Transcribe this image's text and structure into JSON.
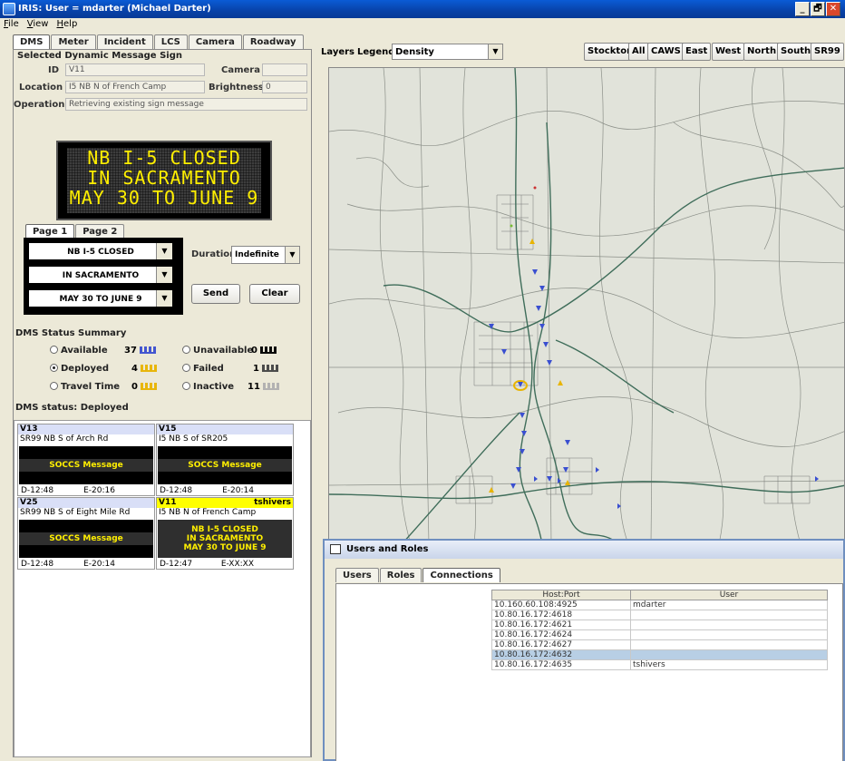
{
  "window": {
    "title": "IRIS: User = mdarter (Michael Darter)",
    "min": "_",
    "max": "🗗",
    "close": "✕"
  },
  "menu": [
    "File",
    "View",
    "Help"
  ],
  "left_tabs": [
    "DMS",
    "Meter",
    "Incident",
    "LCS",
    "Camera",
    "Roadway"
  ],
  "selected_sign": {
    "group_title": "Selected Dynamic Message Sign",
    "id_label": "ID",
    "id_value": "V11",
    "camera_label": "Camera",
    "camera_value": "",
    "location_label": "Location",
    "location_value": "I5 NB N of French Camp",
    "brightness_label": "Brightness",
    "brightness_value": "0",
    "operation_label": "Operation",
    "operation_value": "Retrieving existing sign message",
    "sign_lines": [
      "NB I-5 CLOSED",
      "IN SACRAMENTO",
      "MAY 30 TO JUNE 9"
    ]
  },
  "page_tabs": [
    "Page 1",
    "Page 2"
  ],
  "message_lines": [
    "NB I-5 CLOSED",
    "IN SACRAMENTO",
    "MAY 30 TO JUNE 9"
  ],
  "duration": {
    "label": "Duration",
    "value": "Indefinite"
  },
  "buttons": {
    "send": "Send",
    "clear": "Clear"
  },
  "status_summary": {
    "title": "DMS Status Summary",
    "items": [
      {
        "label": "Available",
        "count": "37",
        "selected": false,
        "color": "#3a4fd0"
      },
      {
        "label": "Deployed",
        "count": "4",
        "selected": true,
        "color": "#e8b400"
      },
      {
        "label": "Travel Time",
        "count": "0",
        "selected": false,
        "color": "#e8b400"
      },
      {
        "label": "Unavailable",
        "count": "0",
        "selected": false,
        "color": "#000000"
      },
      {
        "label": "Failed",
        "count": "1",
        "selected": false,
        "color": "#444444"
      },
      {
        "label": "Inactive",
        "count": "11",
        "selected": false,
        "color": "#b0b0b0"
      }
    ]
  },
  "dms_status_label": "DMS status: Deployed",
  "dms_cards": [
    {
      "id": "V13",
      "user": "",
      "location": "SR99 NB S of Arch Rd",
      "message": [
        "SOCCS Message"
      ],
      "d": "D-12:48",
      "e": "E-20:16"
    },
    {
      "id": "V15",
      "user": "",
      "location": "I5 NB S of SR205",
      "message": [
        "SOCCS Message"
      ],
      "d": "D-12:48",
      "e": "E-20:14"
    },
    {
      "id": "V25",
      "user": "",
      "location": "SR99 NB S of Eight Mile Rd",
      "message": [
        "SOCCS Message"
      ],
      "d": "D-12:48",
      "e": "E-20:14"
    },
    {
      "id": "V11",
      "user": "tshivers",
      "location": "I5 NB N of French Camp",
      "message": [
        "NB I-5 CLOSED",
        "IN SACRAMENTO",
        "MAY 30 TO JUNE 9"
      ],
      "d": "D-12:47",
      "e": "E-XX:XX"
    }
  ],
  "map_toolbar": {
    "layers": "Layers",
    "legend": "Legend",
    "legend_value": "Density",
    "views": [
      "Stockton",
      "All",
      "CAWS",
      "East",
      "West",
      "North",
      "South",
      "SR99"
    ]
  },
  "users_roles": {
    "title": "Users and Roles",
    "tabs": [
      "Users",
      "Roles",
      "Connections"
    ],
    "columns": [
      "Host:Port",
      "User"
    ],
    "rows": [
      [
        "10.160.60.108:4925",
        "mdarter"
      ],
      [
        "10.80.16.172:4618",
        ""
      ],
      [
        "10.80.16.172:4621",
        ""
      ],
      [
        "10.80.16.172:4624",
        ""
      ],
      [
        "10.80.16.172:4627",
        ""
      ],
      [
        "10.80.16.172:4632",
        ""
      ],
      [
        "10.80.16.172:4635",
        "tshivers"
      ]
    ],
    "selected_row": 5
  }
}
